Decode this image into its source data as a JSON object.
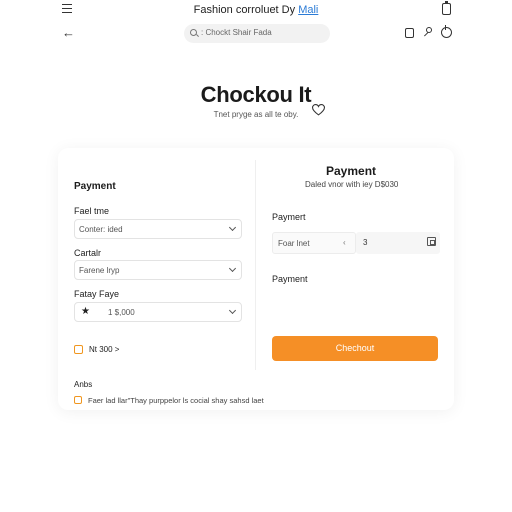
{
  "topbar": {
    "brand_text": "Fashion corroluet Dy",
    "brand_link": "Mali"
  },
  "search": {
    "placeholder": ": Chockt Shair Fada"
  },
  "header": {
    "title": "Chockou It",
    "subtitle": "Tnet pryge as all te oby."
  },
  "left": {
    "section_title": "Payment",
    "field1_label": "Fael tme",
    "field1_value": "Conter: ided",
    "field2_label": "Cartalr",
    "field2_value": "Farene lryp",
    "field3_label": "Fatay Faye",
    "field3_value": "1 $,000",
    "option_label": "Nt 300 >",
    "note_label": "Anbs",
    "terms_text": "Faer lad llar\"Thay purppelor ls cocial shay sahsd laet"
  },
  "right": {
    "title": "Payment",
    "subtitle": "Daled vnor with iey D$030",
    "section1_label": "Paymert",
    "input1_value": "Foar lnet",
    "input1_separator": "‹",
    "input2_value": "3",
    "section2_label": "Payment",
    "checkout_label": "Chechout"
  },
  "colors": {
    "accent": "#f58f26",
    "link": "#2b7bd6",
    "checkbox_border": "#f0961f"
  },
  "icons": [
    "menu-icon",
    "phone-icon",
    "back-icon",
    "search-icon",
    "square-icon",
    "key-icon",
    "power-icon",
    "heart-icon",
    "chevron-down-icon",
    "star-icon",
    "calendar-icon"
  ]
}
